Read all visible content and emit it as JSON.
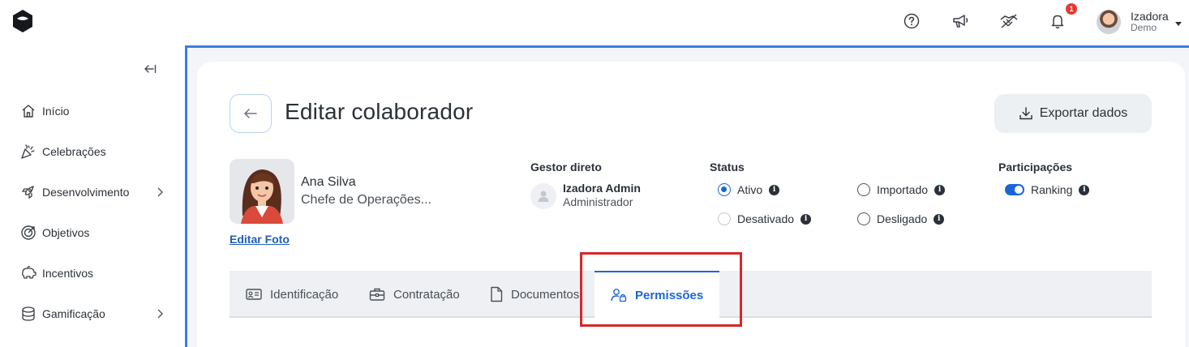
{
  "header": {
    "user": {
      "name": "Izadora",
      "subtitle": "Demo"
    },
    "notifications_count": "1",
    "icons": [
      "help-icon",
      "megaphone-icon",
      "handshake-icon",
      "bell-icon"
    ]
  },
  "sidebar": {
    "items": [
      {
        "label": "Início",
        "icon": "home-icon",
        "has_submenu": false
      },
      {
        "label": "Celebrações",
        "icon": "confetti-icon",
        "has_submenu": false
      },
      {
        "label": "Desenvolvimento",
        "icon": "rocket-icon",
        "has_submenu": true
      },
      {
        "label": "Objetivos",
        "icon": "target-icon",
        "has_submenu": false
      },
      {
        "label": "Incentivos",
        "icon": "piggy-bank-icon",
        "has_submenu": false
      },
      {
        "label": "Gamificação",
        "icon": "coins-icon",
        "has_submenu": true
      }
    ]
  },
  "page": {
    "title": "Editar colaborador",
    "export_label": "Exportar dados"
  },
  "employee": {
    "name": "Ana Silva",
    "role": "Chefe de Operações...",
    "edit_photo_label": "Editar Foto"
  },
  "manager": {
    "section_label": "Gestor direto",
    "name": "Izadora Admin",
    "role": "Administrador"
  },
  "status": {
    "section_label": "Status",
    "options": [
      {
        "label": "Ativo",
        "checked": true
      },
      {
        "label": "Importado",
        "checked": false
      },
      {
        "label": "Desativado",
        "checked": false
      },
      {
        "label": "Desligado",
        "checked": false
      }
    ]
  },
  "participations": {
    "section_label": "Participações",
    "ranking_label": "Ranking",
    "ranking_enabled": true
  },
  "tabs": [
    {
      "label": "Identificação",
      "icon": "id-card-icon",
      "active": false
    },
    {
      "label": "Contratação",
      "icon": "briefcase-icon",
      "active": false
    },
    {
      "label": "Documentos",
      "icon": "document-icon",
      "active": false
    },
    {
      "label": "Permissões",
      "icon": "user-lock-icon",
      "active": true
    }
  ],
  "colors": {
    "accent": "#1a66d6",
    "highlight": "#d62828",
    "frame": "#3b7de0"
  }
}
